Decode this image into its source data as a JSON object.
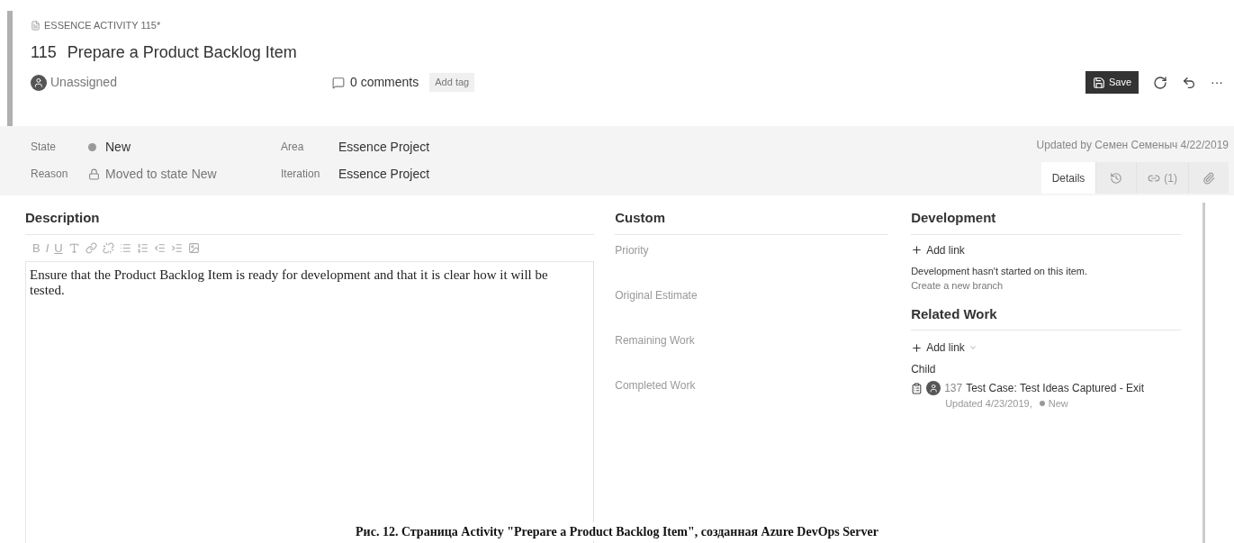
{
  "header": {
    "type_label": "ESSENCE ACTIVITY 115*",
    "id": "115",
    "title": "Prepare a Product Backlog Item",
    "assignee": "Unassigned",
    "comments": "0 comments",
    "add_tag": "Add tag"
  },
  "toolbar": {
    "save": "Save",
    "more": "···"
  },
  "fields": [
    {
      "label": "State",
      "value": "New",
      "kind": "state"
    },
    {
      "label": "Reason",
      "value": "Moved to state New",
      "kind": "lock"
    },
    {
      "label": "Area",
      "value": "Essence Project",
      "kind": "plain"
    },
    {
      "label": "Iteration",
      "value": "Essence Project",
      "kind": "plain"
    }
  ],
  "updated": "Updated by Семен Семеныч 4/22/2019",
  "tabs": [
    {
      "kind": "text",
      "label": "Details",
      "selected": true
    },
    {
      "kind": "history",
      "selected": false
    },
    {
      "kind": "link",
      "label": "(1)",
      "selected": false
    },
    {
      "kind": "attachment",
      "selected": false
    }
  ],
  "description": {
    "title": "Description",
    "format_letters": [
      "B",
      "I",
      "U"
    ],
    "text": "Ensure that the Product Backlog Item is ready for development and that it is clear how it will be tested."
  },
  "custom": {
    "title": "Custom",
    "fields": [
      "Priority",
      "Original Estimate",
      "Remaining Work",
      "Completed Work"
    ]
  },
  "development": {
    "title": "Development",
    "add_link": "Add link",
    "note": "Development hasn't started on this item.",
    "create_branch": "Create a new branch"
  },
  "related_work": {
    "title": "Related Work",
    "add_link": "Add link",
    "group": "Child",
    "items": [
      {
        "id": "137",
        "title": "Test Case: Test Ideas Captured - Exit",
        "updated": "Updated 4/23/2019,",
        "state": "New"
      }
    ]
  },
  "caption": "Рис. 12. Страница Activity \"Prepare a Product Backlog Item\", созданная Azure DevOps Server"
}
